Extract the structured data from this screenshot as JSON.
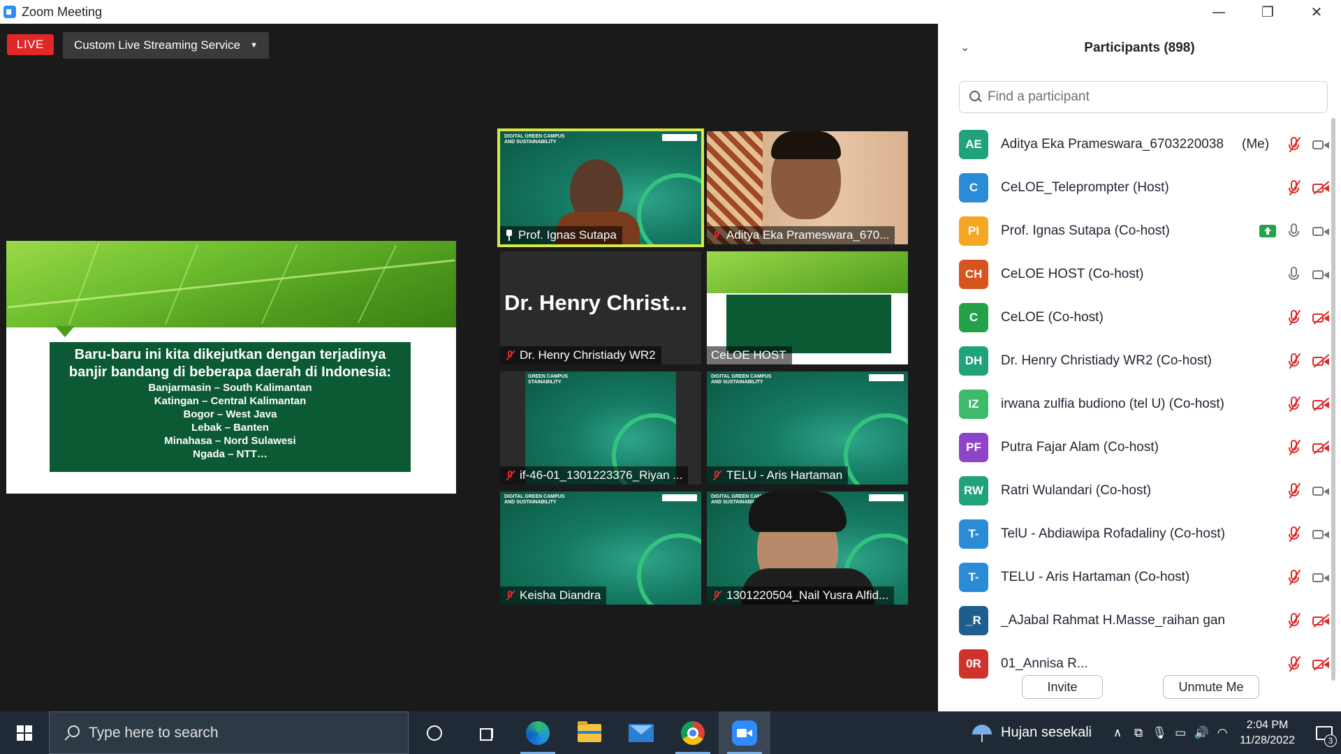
{
  "window": {
    "title": "Zoom Meeting",
    "minimize": "—",
    "maximize": "❐",
    "close": "✕"
  },
  "toolbar": {
    "live_label": "LIVE",
    "stream_service": "Custom Live Streaming Service",
    "stream_caret": "▼"
  },
  "slide": {
    "headline_1": "Baru-baru ini kita dikejutkan dengan terjadinya",
    "headline_2": "banjir bandang di beberapa daerah di Indonesia:",
    "lines": [
      "Banjarmasin – South Kalimantan",
      "Katingan – Central Kalimantan",
      "Bogor – West Java",
      "Lebak – Banten",
      "Minahasa – Nord Sulawesi",
      "Ngada – NTT…"
    ]
  },
  "gallery": {
    "tiles": [
      {
        "name": "Prof. Ignas Sutapa",
        "header": "DIGITAL GREEN CAMPUS AND SUSTAINABILITY"
      },
      {
        "name": "Aditya Eka Prameswara_670..."
      },
      {
        "name": "Dr. Henry Christiady WR2",
        "big_name": "Dr. Henry Christ..."
      },
      {
        "name": "CeLOE HOST"
      },
      {
        "name": "if-46-01_1301223376_Riyan ...",
        "header": "GREEN CAMPUS STAINABILITY"
      },
      {
        "name": "TELU - Aris Hartaman",
        "header": "DIGITAL GREEN CAMPUS AND SUSTAINABILITY"
      },
      {
        "name": "Keisha Diandra",
        "header": "DIGITAL GREEN CAMPUS AND SUSTAINABILITY"
      },
      {
        "name": "1301220504_Nail Yusra Alfid...",
        "header": "DIGITAL GREEN CAMPUS AND SUSTAINABILITY"
      }
    ]
  },
  "participants": {
    "title": "Participants (898)",
    "collapse_glyph": "⌄",
    "search_placeholder": "Find a participant",
    "me_label": "(Me)",
    "list": [
      {
        "initials": "AE",
        "name": "Aditya Eka Prameswara_6703220038...",
        "color": "#20a37b",
        "mic": "muted",
        "cam": "on",
        "me": true
      },
      {
        "initials": "C",
        "name": "CeLOE_Teleprompter (Host)",
        "color": "#2a8bd6",
        "mic": "muted",
        "cam": "off"
      },
      {
        "initials": "PI",
        "name": "Prof. Ignas Sutapa (Co-host)",
        "color": "#f5a623",
        "mic": "on",
        "cam": "on",
        "share": true
      },
      {
        "initials": "CH",
        "name": "CeLOE HOST (Co-host)",
        "color": "#d9531e",
        "mic": "on",
        "cam": "on"
      },
      {
        "initials": "C",
        "name": "CeLOE (Co-host)",
        "color": "#23a24a",
        "mic": "muted",
        "cam": "off"
      },
      {
        "initials": "DH",
        "name": "Dr. Henry Christiady WR2 (Co-host)",
        "color": "#20a37b",
        "mic": "muted",
        "cam": "off"
      },
      {
        "initials": "IZ",
        "name": "irwana zulfia budiono (tel U) (Co-host)",
        "color": "#3dbb6b",
        "mic": "muted",
        "cam": "off"
      },
      {
        "initials": "PF",
        "name": "Putra Fajar Alam (Co-host)",
        "color": "#8e44c8",
        "mic": "muted",
        "cam": "off"
      },
      {
        "initials": "RW",
        "name": "Ratri Wulandari (Co-host)",
        "color": "#20a37b",
        "mic": "muted",
        "cam": "on"
      },
      {
        "initials": "T-",
        "name": "TelU - Abdiawipa Rofadaliny (Co-host)",
        "color": "#2a8bd6",
        "mic": "muted",
        "cam": "on"
      },
      {
        "initials": "T-",
        "name": "TELU - Aris Hartaman (Co-host)",
        "color": "#2a8bd6",
        "mic": "muted",
        "cam": "on"
      },
      {
        "initials": "_R",
        "name": "_AJabal Rahmat H.Masse_raihan ganhany",
        "color": "#1f5d8c",
        "mic": "muted",
        "cam": "off"
      },
      {
        "initials": "0R",
        "name": "01_Annisa R...",
        "color": "#d0332b",
        "mic": "muted",
        "cam": "off"
      }
    ],
    "invite_label": "Invite",
    "unmute_label": "Unmute Me"
  },
  "taskbar": {
    "search_placeholder": "Type here to search",
    "weather_text": "Hujan sesekali",
    "time": "2:04 PM",
    "date": "11/28/2022",
    "notification_count": "3",
    "tray_chevron": "∧"
  }
}
